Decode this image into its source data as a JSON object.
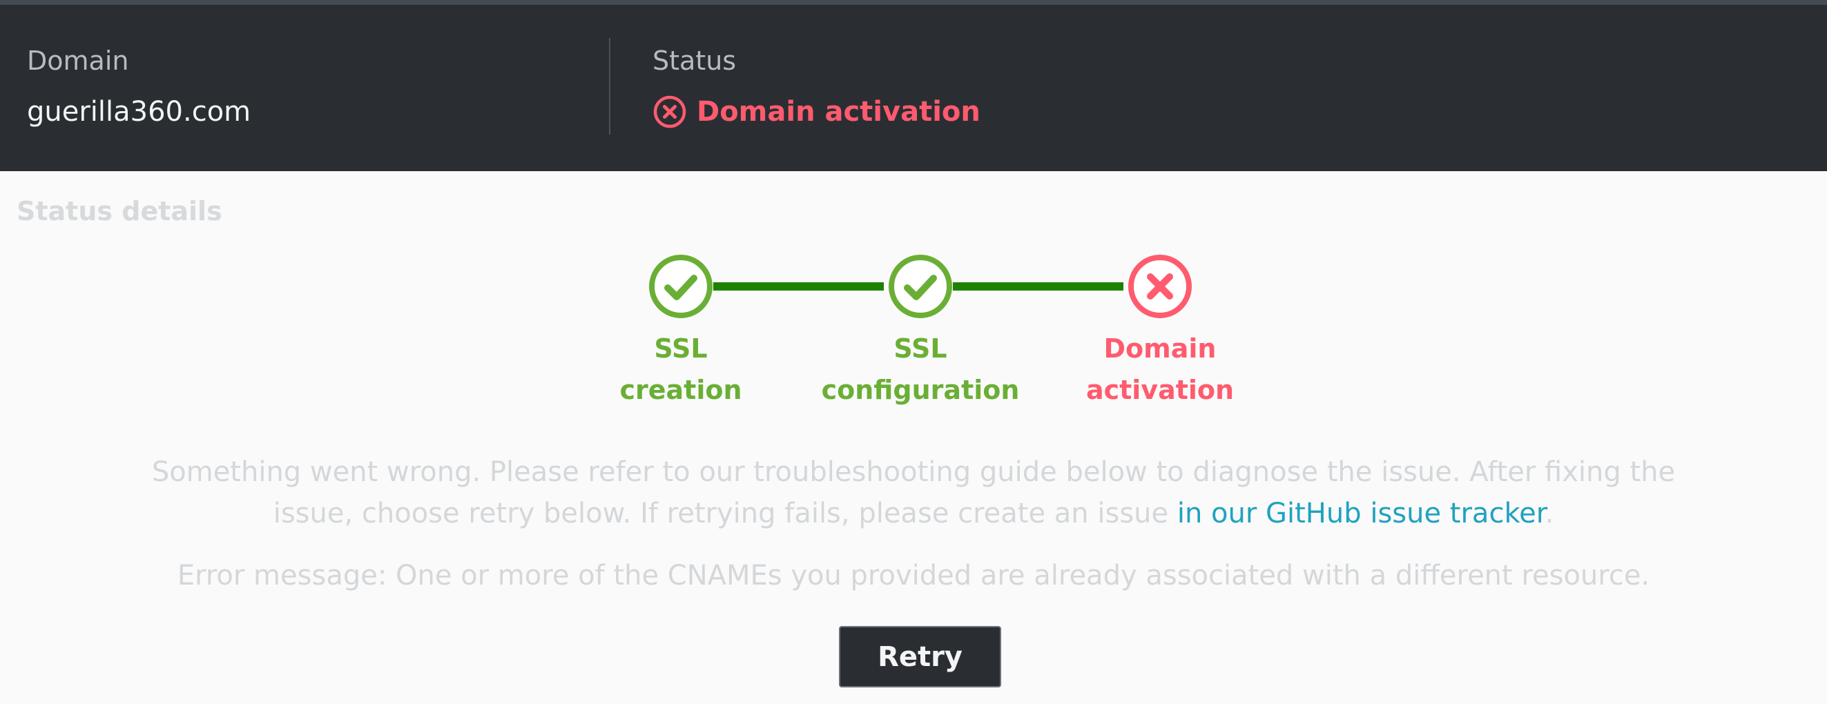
{
  "header": {
    "domain_label": "Domain",
    "domain_value": "guerilla360.com",
    "status_label": "Status",
    "status_value": "Domain activation",
    "status_icon": "error-circle-icon",
    "status_color": "#ff5b6e"
  },
  "status_details": {
    "title": "Status details",
    "steps": [
      {
        "line1": "SSL",
        "line2": "creation",
        "state": "success",
        "icon": "check-circle-icon"
      },
      {
        "line1": "SSL",
        "line2": "configuration",
        "state": "success",
        "icon": "check-circle-icon"
      },
      {
        "line1": "Domain",
        "line2": "activation",
        "state": "error",
        "icon": "error-circle-icon"
      }
    ],
    "colors": {
      "success": "#6aaf35",
      "connector": "#1d8102",
      "error": "#ff5b6e",
      "link": "#1fa2c0"
    }
  },
  "message": {
    "line1": "Something went wrong. Please refer to our troubleshooting guide below to diagnose the issue. After fixing the",
    "line2_prefix": "issue, choose retry below. If retrying fails, please create an issue ",
    "link_text": "in our GitHub issue tracker",
    "line2_suffix": "."
  },
  "error_message": "Error message: One or more of the CNAMEs you provided are already associated with a different resource.",
  "retry_button": "Retry"
}
